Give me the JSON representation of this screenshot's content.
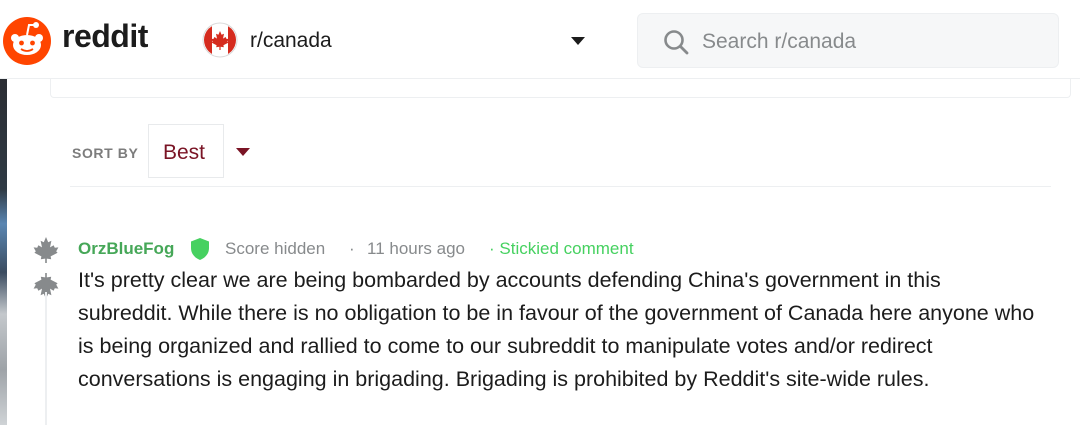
{
  "header": {
    "wordmark": "reddit",
    "community_name": "r/canada",
    "search_placeholder": "Search r/canada",
    "icons": {
      "logo": "reddit-snoo-logo",
      "community": "canada-flag-icon",
      "dropdown": "caret-down-icon",
      "search": "search-icon"
    }
  },
  "sort": {
    "label": "SORT BY",
    "value": "Best"
  },
  "comment": {
    "author": "OrzBlueFog",
    "author_badge": "mod-shield-icon",
    "score": "Score hidden",
    "separator": "·",
    "time": "11 hours ago",
    "stickied": "· Stickied comment",
    "body": "It's pretty clear we are being bombarded by accounts defending China's government in this subreddit. While there is no obligation to be in favour of the government of Canada here anyone who is being organized and rallied to come to our subreddit to manipulate votes and/or redirect conversations is engaging in brigading. Brigading is prohibited by Reddit's site-wide rules.",
    "vote_icons": [
      "maple-leaf-upvote-icon",
      "maple-leaf-downvote-icon"
    ]
  },
  "colors": {
    "brand": "#ff4500",
    "author": "#46a758",
    "stickied": "#46d160",
    "sort_value": "#7a1425",
    "sort_caret": "#7a1425",
    "meta_text": "#878a8c",
    "body_text": "#1c1c1c"
  }
}
